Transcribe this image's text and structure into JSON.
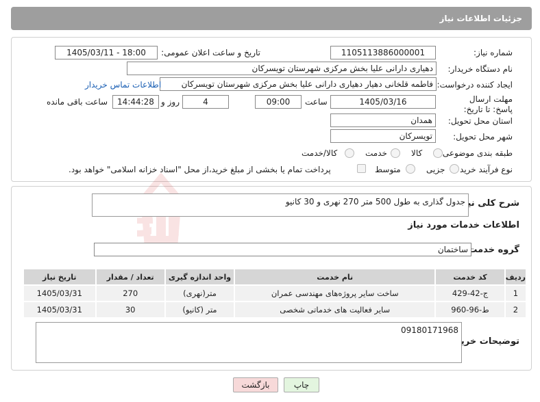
{
  "header": {
    "title": "جزئیات اطلاعات نیاز"
  },
  "form": {
    "need_number_label": "شماره نیاز:",
    "need_number": "1105113886000001",
    "announce_label": "تاریخ و ساعت اعلان عمومی:",
    "announce_value": "1405/03/11 - 18:00",
    "buyer_org_label": "نام دستگاه خریدار:",
    "buyer_org": "دهیاری دارانی علیا بخش مرکزی شهرستان تویسرکان",
    "creator_label": "ایجاد کننده درخواست:",
    "creator": "فاطمه قلخانی دهیار دهیاری دارانی علیا بخش مرکزی شهرستان تویسرکان",
    "contact_link": "اطلاعات تماس خریدار",
    "deadline_label": "مهلت ارسال پاسخ: تا تاریخ:",
    "deadline_date": "1405/03/16",
    "time_label": "ساعت",
    "deadline_time": "09:00",
    "days_value": "4",
    "days_label": "روز و",
    "remaining_time": "14:44:28",
    "remaining_label": "ساعت باقی مانده",
    "province_label": "استان محل تحویل:",
    "province": "همدان",
    "city_label": "شهر محل تحویل:",
    "city": "تویسرکان",
    "category_label": "طبقه بندی موضوعی:",
    "category_options": [
      "کالا",
      "خدمت",
      "کالا/خدمت"
    ],
    "category_selected": "خدمت",
    "process_label": "نوع فرآیند خرید :",
    "process_options": [
      "جزیی",
      "متوسط"
    ],
    "payment_note": "پرداخت تمام یا بخشی از مبلغ خرید،از محل \"اسناد خزانه اسلامی\" خواهد بود."
  },
  "details": {
    "summary_label": "شرح کلی نیاز:",
    "summary": "جدول گذاری به طول 500 متر 270 نهری و 30 کانیو",
    "services_title": "اطلاعات خدمات مورد نیاز",
    "service_group_label": "گروه خدمت:",
    "service_group": "ساختمان",
    "table": {
      "headers": [
        "ردیف",
        "کد خدمت",
        "نام خدمت",
        "واحد اندازه گیری",
        "تعداد / مقدار",
        "تاریخ نیاز"
      ],
      "rows": [
        [
          "1",
          "ج-42-429",
          "ساخت سایر پروژه‌های مهندسی عمران",
          "متر(نهری)",
          "270",
          "1405/03/31"
        ],
        [
          "2",
          "ط-96-960",
          "سایر فعالیت های خدماتی شخصی",
          "متر (کانیو)",
          "30",
          "1405/03/31"
        ]
      ]
    },
    "buyer_notes_label": "توضیحات خریدار:",
    "buyer_notes": "09180171968"
  },
  "buttons": {
    "back": "بازگشت",
    "print": "چاپ"
  },
  "watermark": {
    "text": "AriaTender.neT"
  },
  "colors": {
    "header_bg": "#9e9e9e",
    "link": "#1a5fb4",
    "back_button": "#f7d9d9",
    "print_button": "#e3f5df",
    "watermark": "#d32f2f"
  }
}
